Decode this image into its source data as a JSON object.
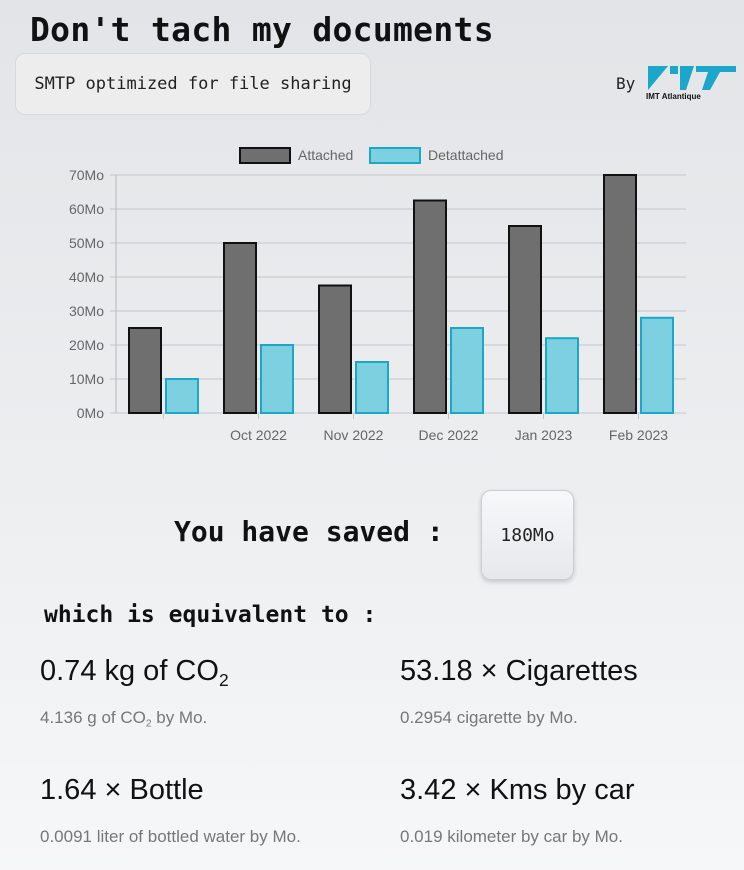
{
  "header": {
    "title": "Don't tach my documents",
    "subtitle": "SMTP optimized for file sharing",
    "by_label": "By",
    "logo_text": "IMT Atlantique"
  },
  "chart_data": {
    "type": "bar",
    "categories": [
      "",
      "Oct 2022",
      "Nov 2022",
      "Dec 2022",
      "Jan 2023",
      "Feb 2023"
    ],
    "series": [
      {
        "name": "Attached",
        "values": [
          25,
          50,
          37.5,
          62.5,
          55,
          70
        ],
        "color": "#6f6f6f",
        "border": "#111111"
      },
      {
        "name": "Detattached",
        "values": [
          10,
          20,
          15,
          25,
          22,
          28
        ],
        "color": "#7dd0e0",
        "border": "#1aa7c9"
      }
    ],
    "ylim": [
      0,
      70
    ],
    "y_ticks": [
      "0Mo",
      "10Mo",
      "20Mo",
      "30Mo",
      "40Mo",
      "50Mo",
      "60Mo",
      "70Mo"
    ],
    "grid": true,
    "legend": "top"
  },
  "savings": {
    "label": "You have saved :",
    "value": "180Mo"
  },
  "equivalence": {
    "label": "which is equivalent to :",
    "co2": {
      "value_prefix": "0.74 kg of CO",
      "value_sub": "2",
      "desc_prefix": "4.136 g of CO",
      "desc_sub": "2",
      "desc_suffix": " by Mo."
    },
    "cigarettes": {
      "value": "53.18 × Cigarettes",
      "desc": "0.2954 cigarette by Mo."
    },
    "bottle": {
      "value": "1.64 × Bottle",
      "desc": "0.0091 liter of bottled water by Mo."
    },
    "car": {
      "value": "3.42 × Kms by car",
      "desc": "0.019 kilometer by car by Mo."
    }
  },
  "colors": {
    "attached": "#6f6f6f",
    "detattached": "#7dd0e0",
    "brand": "#1aa7c9"
  }
}
